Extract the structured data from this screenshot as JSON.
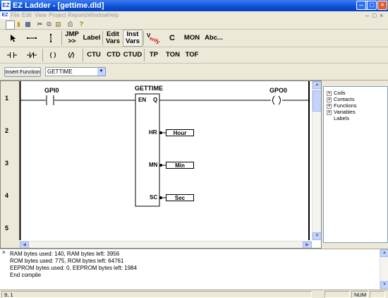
{
  "window": {
    "title": "EZ Ladder - [gettime.dld]",
    "app_icon": "EZ"
  },
  "menu": {
    "icon": "EZ",
    "items": [
      "File",
      "Edit",
      "View",
      "Project",
      "Reports",
      "Window",
      "Help"
    ]
  },
  "toolbar_row1": {
    "pointer": "pointer-icon",
    "hline": "horizontal-line-icon",
    "vline": "vertical-line-icon",
    "jmp": "JMP\n>>",
    "label": "Label",
    "edit_vars": "Edit\nVars",
    "inst_vars": "Inst\nVars",
    "verify": "verify-icon",
    "c": "C",
    "mon": "MON",
    "abc": "Abc..."
  },
  "toolbar_row2": {
    "ctu": "CTU",
    "ctd": "CTD",
    "ctud": "CTUD",
    "tp": "TP",
    "ton": "TON",
    "tof": "TOF"
  },
  "function_bar": {
    "insert_label": "Insert Function",
    "selected": "GETTIME"
  },
  "ladder": {
    "rung_numbers": [
      "1",
      "2",
      "3",
      "4",
      "5"
    ],
    "contact_label": "GPI0",
    "block_label": "GETTIME",
    "coil_label": "GPO0",
    "block_pins": {
      "en": "EN",
      "q": "Q",
      "hr": "HR",
      "mn": "MN",
      "sc": "SC"
    },
    "outputs": {
      "hr": "Hour",
      "mn": "Min",
      "sc": "Sec"
    }
  },
  "tree": {
    "items": [
      {
        "label": "Coils",
        "expandable": true
      },
      {
        "label": "Contacts",
        "expandable": true
      },
      {
        "label": "Functions",
        "expandable": true
      },
      {
        "label": "Variables",
        "expandable": true
      },
      {
        "label": "Labels",
        "expandable": false
      }
    ]
  },
  "output": {
    "lines": [
      "RAM bytes used: 140, RAM bytes left: 3956",
      "ROM bytes used: 775, ROM bytes left: 64761",
      "EEPROM bytes used: 0, EEPROM bytes left: 1984",
      "End compile"
    ]
  },
  "status": {
    "position": "9, 1",
    "num": "NUM"
  },
  "colors": {
    "titlebar": "#0a4fd8",
    "chrome": "#ece9d8",
    "close_button": "#e05a2a"
  }
}
